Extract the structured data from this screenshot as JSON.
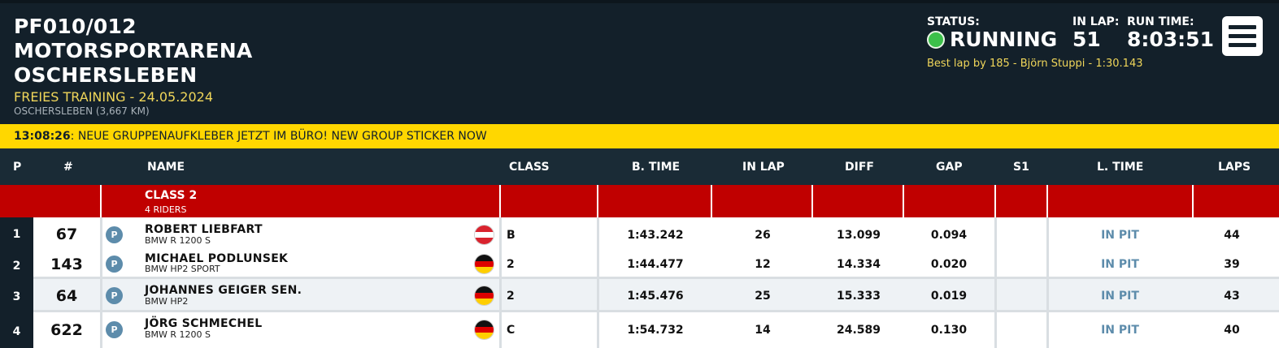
{
  "header": {
    "title_lines": [
      "PF010/012",
      "MOTORSPORTARENA",
      "OSCHERSLEBEN"
    ],
    "subtitle": "FREIES TRAINING - 24.05.2024",
    "track": "OSCHERSLEBEN (3,667 KM)",
    "status_label": "STATUS:",
    "status_value": "RUNNING",
    "inlap_label": "IN LAP:",
    "inlap_value": "51",
    "runtime_label": "RUN TIME:",
    "runtime_value": "8:03:51",
    "best_lap": "Best lap by 185 - Björn Stuppi - 1:30.143",
    "menu_icon": "hamburger-menu-icon",
    "status_color": "#3cc04a"
  },
  "ticker": {
    "time": "13:08:26",
    "message": ": NEUE GRUPPENAUFKLEBER JETZT IM BÜRO! NEW GROUP STICKER NOW"
  },
  "columns": {
    "p": "P",
    "num": "#",
    "name": "NAME",
    "class": "CLASS",
    "btime": "B. TIME",
    "inlap": "IN LAP",
    "diff": "DIFF",
    "gap": "GAP",
    "s1": "S1",
    "ltime": "L. TIME",
    "laps": "LAPS"
  },
  "class_group": {
    "name": "CLASS 2",
    "count": "4 RIDERS",
    "color": "#c00000"
  },
  "rows": [
    {
      "pos": "1",
      "num": "67",
      "badge": "P",
      "rider": "ROBERT LIEBFART",
      "bike": "BMW R 1200 S",
      "flag": "austria-flag-icon",
      "cls": "B",
      "btime": "1:43.242",
      "inlap": "26",
      "diff": "13.099",
      "gap": "0.094",
      "s1": "",
      "ltime": "IN PIT",
      "laps": "44"
    },
    {
      "pos": "2",
      "num": "143",
      "badge": "P",
      "rider": "MICHAEL PODLUNSEK",
      "bike": "BMW HP2 SPORT",
      "flag": "germany-flag-icon",
      "cls": "2",
      "btime": "1:44.477",
      "inlap": "12",
      "diff": "14.334",
      "gap": "0.020",
      "s1": "",
      "ltime": "IN PIT",
      "laps": "39"
    },
    {
      "pos": "3",
      "num": "64",
      "badge": "P",
      "rider": "JOHANNES GEIGER SEN.",
      "bike": "BMW HP2",
      "flag": "germany-flag-icon",
      "cls": "2",
      "btime": "1:45.476",
      "inlap": "25",
      "diff": "15.333",
      "gap": "0.019",
      "s1": "",
      "ltime": "IN PIT",
      "laps": "43"
    },
    {
      "pos": "4",
      "num": "622",
      "badge": "P",
      "rider": "JÖRG SCHMECHEL",
      "bike": "BMW R 1200 S",
      "flag": "germany-flag-icon",
      "cls": "C",
      "btime": "1:54.732",
      "inlap": "14",
      "diff": "24.589",
      "gap": "0.130",
      "s1": "",
      "ltime": "IN PIT",
      "laps": "40"
    }
  ]
}
